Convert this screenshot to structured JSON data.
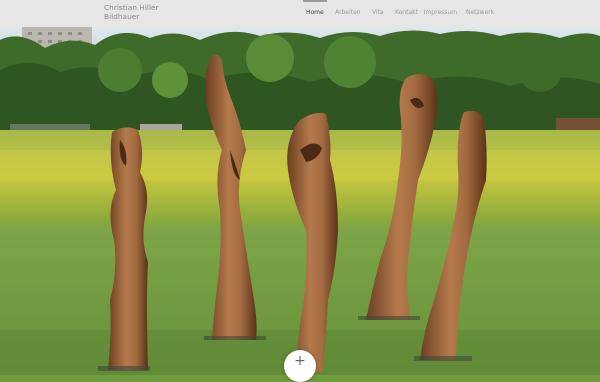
{
  "site": {
    "name_line1": "Christian Hiller",
    "name_line2": "Bildhauer"
  },
  "nav": {
    "items": [
      "Home",
      "Arbeiten",
      "Vita",
      "Kontakt · Impressum",
      "Netzwerk"
    ],
    "active": "Home"
  },
  "hero": {
    "image_description_icon": "sculpture-photo"
  },
  "fab": {
    "label": "+"
  }
}
